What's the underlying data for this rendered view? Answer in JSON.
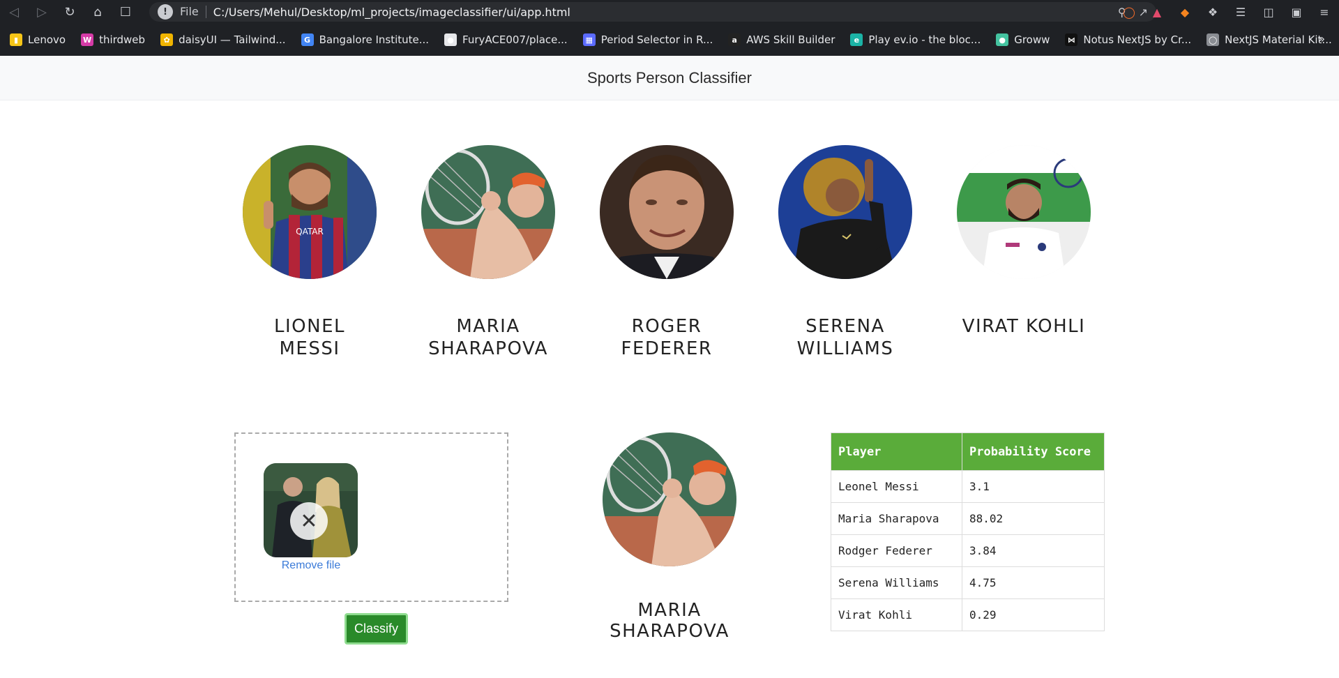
{
  "browser": {
    "url_scheme": "File",
    "url": "C:/Users/Mehul/Desktop/ml_projects/imageclassifier/ui/app.html",
    "bookmarks": [
      {
        "label": "Lenovo",
        "icon": "folder-icon",
        "color": "#f5c518"
      },
      {
        "label": "thirdweb",
        "icon": "thirdweb-icon",
        "color": "#d63ba7"
      },
      {
        "label": "daisyUI — Tailwind...",
        "icon": "daisy-icon",
        "color": "#f0b400"
      },
      {
        "label": "Bangalore Institute...",
        "icon": "google-icon",
        "color": "#4285f4"
      },
      {
        "label": "FuryACE007/place...",
        "icon": "github-icon",
        "color": "#e6e7ea"
      },
      {
        "label": "Period Selector in R...",
        "icon": "grid-icon",
        "color": "#5b6bff"
      },
      {
        "label": "AWS Skill Builder",
        "icon": "aws-icon",
        "color": "#222222"
      },
      {
        "label": "Play ev.io - the bloc...",
        "icon": "evio-icon",
        "color": "#1bb3a6"
      },
      {
        "label": "Groww",
        "icon": "groww-icon",
        "color": "#44c3a0"
      },
      {
        "label": "Notus NextJS by Cr...",
        "icon": "bowtie-icon",
        "color": "#111111"
      },
      {
        "label": "NextJS Material Kit...",
        "icon": "globe-icon",
        "color": "#8a8d93"
      }
    ]
  },
  "header": {
    "title": "Sports Person Classifier"
  },
  "players": [
    {
      "name_line1": "LIONEL",
      "name_line2": "MESSI"
    },
    {
      "name_line1": "MARIA",
      "name_line2": "SHARAPOVA"
    },
    {
      "name_line1": "ROGER",
      "name_line2": "FEDERER"
    },
    {
      "name_line1": "SERENA",
      "name_line2": "WILLIAMS"
    },
    {
      "name_line1": "VIRAT KOHLI",
      "name_line2": ""
    }
  ],
  "upload": {
    "remove_label": "Remove file",
    "classify_label": "Classify"
  },
  "result": {
    "name": "MARIA SHARAPOVA"
  },
  "table": {
    "headers": [
      "Player",
      "Probability Score"
    ],
    "rows": [
      {
        "player": "Leonel Messi",
        "score": "3.1"
      },
      {
        "player": "Maria Sharapova",
        "score": "88.02"
      },
      {
        "player": "Rodger Federer",
        "score": "3.84"
      },
      {
        "player": "Serena Williams",
        "score": "4.75"
      },
      {
        "player": "Virat Kohli",
        "score": "0.29"
      }
    ]
  }
}
